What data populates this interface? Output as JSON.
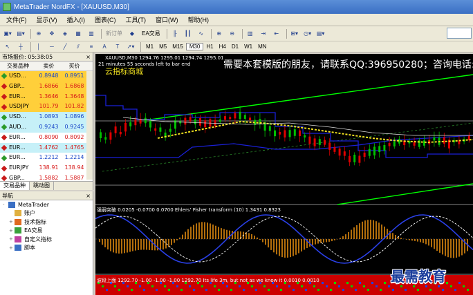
{
  "window": {
    "title": "MetaTrader NordFX - [XAUUSD,M30]"
  },
  "menu": [
    "文件(F)",
    "显示(V)",
    "插入(I)",
    "图表(C)",
    "工具(T)",
    "窗口(W)",
    "帮助(H)"
  ],
  "toolbar": {
    "new_order": "新订单",
    "expert": "EA交易"
  },
  "timeframes": [
    "M1",
    "M5",
    "M15",
    "M30",
    "H1",
    "H4",
    "D1",
    "W1",
    "MN"
  ],
  "market_watch": {
    "header": "市场报价: 05:38:05",
    "columns": {
      "symbol": "交易品种",
      "bid": "卖价",
      "ask": "买价"
    },
    "rows": [
      {
        "symbol": "USD...",
        "bid": "0.8948",
        "ask": "0.8951",
        "dir": "up",
        "bg": "#ffcf3a"
      },
      {
        "symbol": "GBP...",
        "bid": "1.6866",
        "ask": "1.6868",
        "dir": "down",
        "bg": "#ffcf3a"
      },
      {
        "symbol": "EUR...",
        "bid": "1.3646",
        "ask": "1.3648",
        "dir": "down",
        "bg": "#ffcf3a"
      },
      {
        "symbol": "USDJPY",
        "bid": "101.79",
        "ask": "101.82",
        "dir": "down",
        "bg": "#ffcf3a"
      },
      {
        "symbol": "USD...",
        "bid": "1.0893",
        "ask": "1.0896",
        "dir": "up",
        "bg": "#c6f0f8"
      },
      {
        "symbol": "AUD...",
        "bid": "0.9243",
        "ask": "0.9245",
        "dir": "up",
        "bg": "#c6f0f8"
      },
      {
        "symbol": "EUR...",
        "bid": "0.8090",
        "ask": "0.8092",
        "dir": "down",
        "bg": "#ffffff"
      },
      {
        "symbol": "EUR...",
        "bid": "1.4762",
        "ask": "1.4765",
        "dir": "down",
        "bg": "#c6f0f8"
      },
      {
        "symbol": "EUR...",
        "bid": "1.2212",
        "ask": "1.2214",
        "dir": "up",
        "bg": "#ffffff"
      },
      {
        "symbol": "EURJPY",
        "bid": "138.91",
        "ask": "138.94",
        "dir": "down",
        "bg": "#ffffff"
      },
      {
        "symbol": "GBP...",
        "bid": "1.5882",
        "ask": "1.5887",
        "dir": "down",
        "bg": "#ffffff"
      }
    ],
    "tabs": [
      "交易品种",
      "跳动图"
    ]
  },
  "navigator": {
    "header": "导航",
    "items": [
      {
        "label": "MetaTrader",
        "color": "#3a6fc4",
        "indent": 0,
        "exp": "-"
      },
      {
        "label": "账户",
        "color": "#e0b040",
        "indent": 1,
        "exp": ""
      },
      {
        "label": "技术指标",
        "color": "#e06a20",
        "indent": 1,
        "exp": "+"
      },
      {
        "label": "EA交易",
        "color": "#3aa03a",
        "indent": 1,
        "exp": "+"
      },
      {
        "label": "自定义指标",
        "color": "#c040a0",
        "indent": 1,
        "exp": "+"
      },
      {
        "label": "脚本",
        "color": "#3a6fc4",
        "indent": 1,
        "exp": "+"
      }
    ]
  },
  "chart": {
    "header": "XAUUSD,M30  1294.76 1295.01 1294.74 1295.01",
    "timer": "21 minutes 55 seconds left to bar end",
    "ad_text": "需要本套模版的朋友，请联系QQ:396950280；咨询电话:1",
    "brand": "云指标商城",
    "indicator1": "强弱突破 0.0205 -0.0700 0.0700  Ehlers' Fisher transform (10) 1.3431 0.8323",
    "indicator2": "波段上面 1292.70 -1.00 -1.00 -1.00 1292.70  Its life 3m, but not as we know it  0.0010 0.0010",
    "watermark": "最需教育",
    "colors": {
      "up": "#00c000",
      "down": "#e00000",
      "channel": "#00ff00",
      "line": "#1a20d8"
    }
  }
}
